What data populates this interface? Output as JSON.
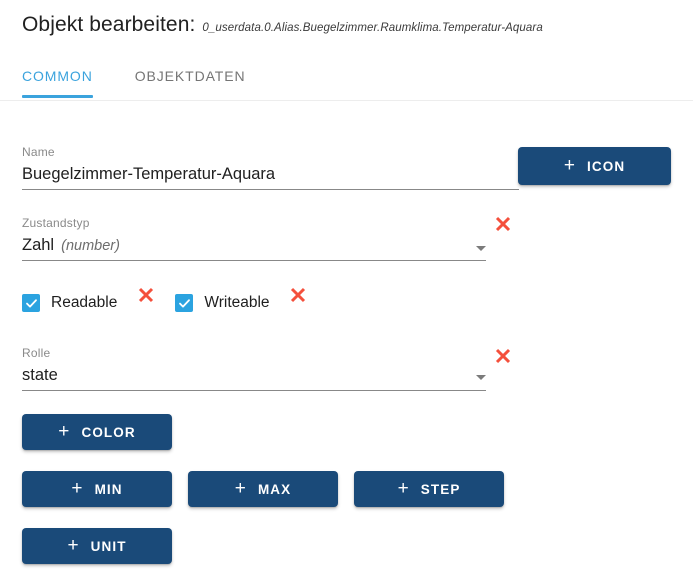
{
  "header": {
    "title": "Objekt bearbeiten:",
    "subtitle": "0_userdata.0.Alias.Buegelzimmer.Raumklima.Temperatur-Aquara"
  },
  "tabs": [
    {
      "label": "COMMON",
      "active": true
    },
    {
      "label": "OBJEKTDATEN",
      "active": false
    }
  ],
  "fields": {
    "name": {
      "label": "Name",
      "value": "Buegelzimmer-Temperatur-Aquara",
      "placeholder": "Name"
    },
    "state_type": {
      "label": "Zustandstyp",
      "value": "Zahl",
      "hint": "(number)"
    },
    "role": {
      "label": "Rolle",
      "value": "state"
    }
  },
  "checkboxes": [
    {
      "label": "Readable",
      "checked": true
    },
    {
      "label": "Writeable",
      "checked": true
    }
  ],
  "buttons": {
    "icon": "ICON",
    "color": "COLOR",
    "min": "MIN",
    "max": "MAX",
    "step": "STEP",
    "unit": "UNIT",
    "plus": "+"
  },
  "colors": {
    "button_navy": "#1a4a79",
    "tab_active_blue": "#3ba3dd",
    "checkbox_blue": "#2ba3e0",
    "clear_red": "#f4503c",
    "label_gray": "#8a8a8a"
  }
}
